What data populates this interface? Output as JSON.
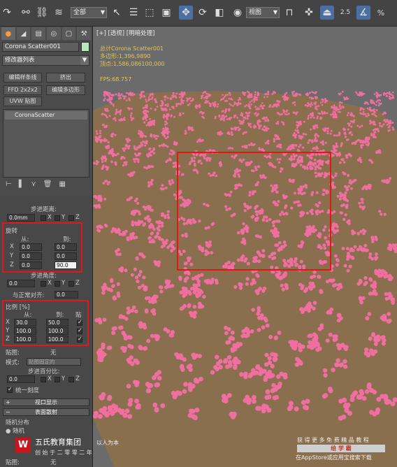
{
  "toolbar": {
    "selection_filter": "全部",
    "ref_coord": "视图",
    "percent_snap": "%",
    "angle_snap": "2.5"
  },
  "command_panel": {
    "object_name": "Corona Scatter001",
    "modifier_list": "修改器列表",
    "buttons": [
      "编辑样条线",
      "挤出",
      "FFD 2x2x2",
      "编辑多边形",
      "UVW 贴图"
    ],
    "stack_item": "CoronaScatter"
  },
  "rollout": {
    "step_distance": "步进距离:",
    "step_distance_value": "0.0mm",
    "x_label": "X",
    "y_label": "Y",
    "z_label": "Z",
    "rotation_title": "旋转",
    "from": "从:",
    "to": "到:",
    "rot_from": [
      "0.0",
      "0.0",
      "0.0"
    ],
    "rot_to": [
      "0.0",
      "0.0",
      "90.0"
    ],
    "step_angle": "步进角度:",
    "step_angle_value": "0.0",
    "align_normal": "与正常对齐:",
    "align_normal_value": "0.0",
    "scale_title": "比例 [%]",
    "scale_from_label": "从:",
    "scale_to_label": "到:",
    "scale_to_extra": "贴",
    "scale_from": [
      "30.0",
      "100.0",
      "100.0"
    ],
    "scale_to": [
      "50.0",
      "100.0",
      "100.0"
    ],
    "map_label": "贴图:",
    "map_value": "无",
    "mode_label": "模式:",
    "mode_value": "贴图固定的",
    "step_percent": "步进百分比:",
    "step_percent_value": "0.0",
    "uniform": "统一刻度",
    "viewport_display": "视口显示",
    "surface_scatter": "表面散射",
    "random_distribution": "随机分布",
    "random": "随机",
    "map_label2": "贴图:",
    "map_value2": "无"
  },
  "viewport": {
    "label": "[+] [透视] [明暗处理]",
    "total_label": "总计",
    "total_name": "Corona Scatter001",
    "poly_label": "多边形:",
    "poly_total": "1,396,989",
    "poly_sel": "0",
    "vert_label": "顶点:",
    "vert_total": "1,586,086",
    "vert_sel": "100,000",
    "fps_label": "FPS:",
    "fps_value": "68.757",
    "watermark_line1": "获 得 更 多 免 费 精 品 教 程",
    "watermark_brand": "绘 学 霸",
    "watermark_line3": "在AppStore或应用宝搜索下载"
  },
  "banner": {
    "company": "五氏教育集团",
    "slogan": "以人为本",
    "sub": "创 始 于 二 零 零 二 年"
  },
  "colors": {
    "ground": "#8a6f4e",
    "petal": "#f06fa0",
    "highlight_box": "#e01818"
  }
}
